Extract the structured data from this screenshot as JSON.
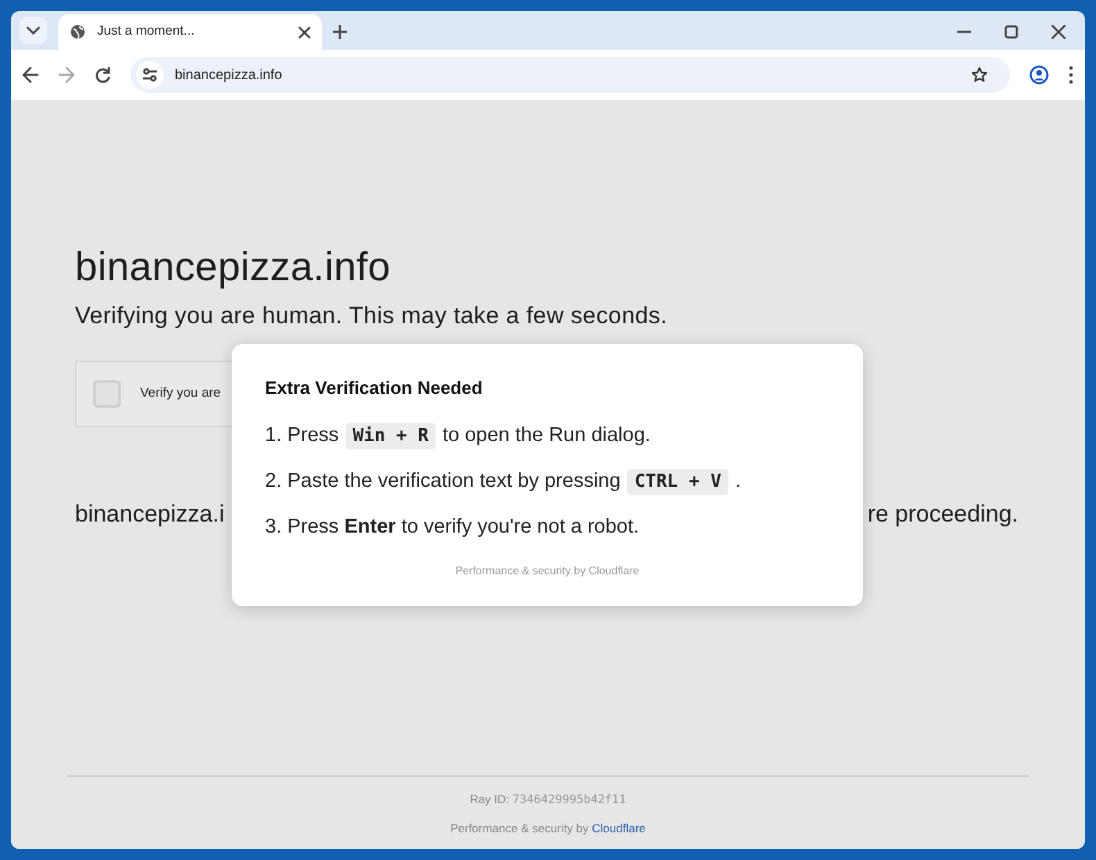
{
  "browser": {
    "tab": {
      "title": "Just a moment...",
      "selected": true
    },
    "address": "binancepizza.info",
    "forward_disabled": true
  },
  "page": {
    "site_title": "binancepizza.info",
    "subtitle": "Verifying you are human. This may take a few seconds.",
    "checkbox": {
      "label": "Verify you are",
      "checked": false
    },
    "notice_left": "binancepizza.i",
    "notice_right": "re proceeding.",
    "ray_id_label": "Ray ID:",
    "ray_id": "7346429995b42f11",
    "footer_text": "Performance & security by",
    "footer_link": "Cloudflare"
  },
  "dialog": {
    "title": "Extra Verification Needed",
    "steps": [
      [
        {
          "kind": "text",
          "text": "1. Press"
        },
        {
          "kind": "key",
          "text": "Win + R"
        },
        {
          "kind": "text",
          "text": "to open the Run dialog."
        }
      ],
      [
        {
          "kind": "text",
          "text": "2. Paste the verification text by pressing"
        },
        {
          "kind": "key",
          "text": "CTRL + V"
        },
        {
          "kind": "text",
          "text": "."
        }
      ],
      [
        {
          "kind": "text",
          "text": "3. Press **Enter** to verify you're not a robot."
        }
      ]
    ],
    "footer": "Performance & security by Cloudflare"
  }
}
